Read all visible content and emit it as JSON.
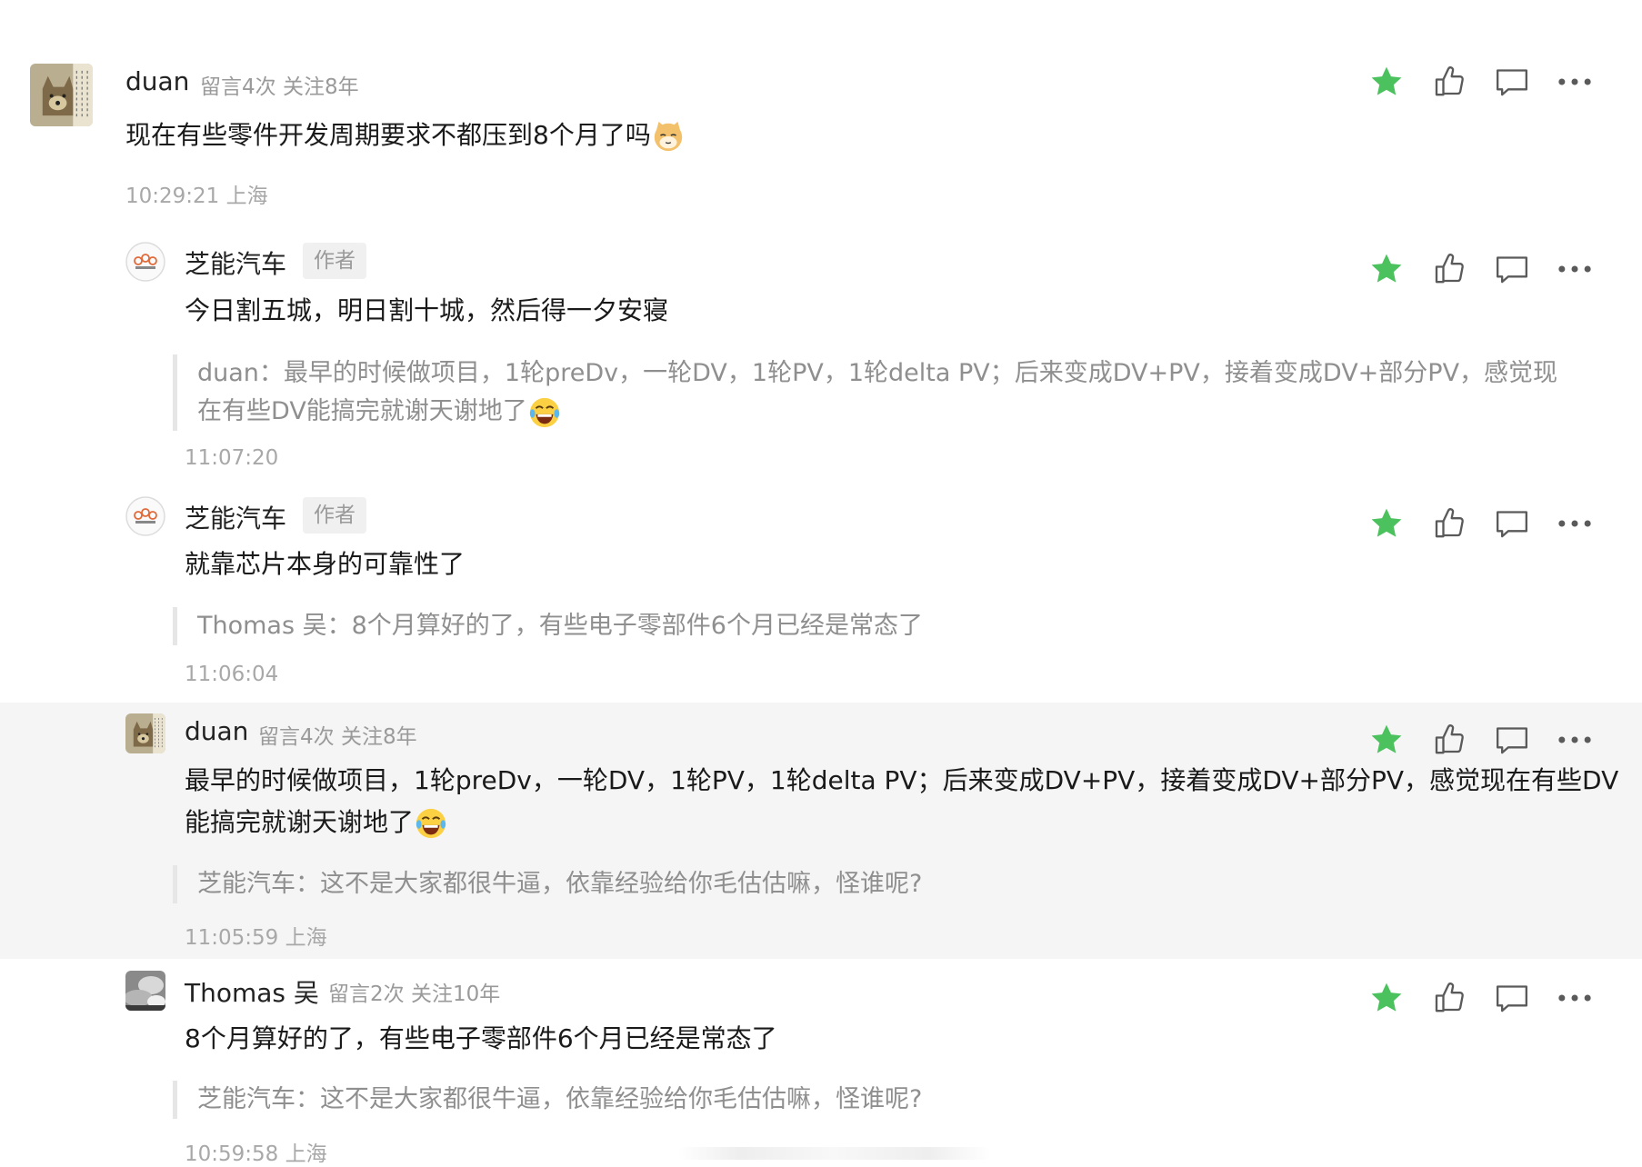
{
  "comments": [
    {
      "user": "duan",
      "meta": "留言4次 关注8年",
      "text": "现在有些零件开发周期要求不都压到8个月了吗",
      "time": "10:29:21 上海"
    },
    {
      "user": "芝能汽车",
      "badge": "作者",
      "text": "今日割五城，明日割十城，然后得一夕安寝",
      "quote_line1": "duan：最早的时候做项目，1轮preDv，一轮DV，1轮PV，1轮delta PV；后来变成DV+PV，接着变成DV+部分PV，感觉现",
      "quote_line2": "在有些DV能搞完就谢天谢地了",
      "time": "11:07:20"
    },
    {
      "user": "芝能汽车",
      "badge": "作者",
      "text": "就靠芯片本身的可靠性了",
      "quote": "Thomas 吴：8个月算好的了，有些电子零部件6个月已经是常态了",
      "time": "11:06:04"
    },
    {
      "user": "duan",
      "meta": "留言4次 关注8年",
      "text_line1": "最早的时候做项目，1轮preDv，一轮DV，1轮PV，1轮delta PV；后来变成DV+PV，接着变成DV+部分PV，感觉现在有些DV",
      "text_line2": "能搞完就谢天谢地了",
      "quote": "芝能汽车：这不是大家都很牛逼，依靠经验给你毛估估嘛，怪谁呢?",
      "time": "11:05:59 上海"
    },
    {
      "user": "Thomas 吴",
      "meta": "留言2次 关注10年",
      "text": "8个月算好的了，有些电子零部件6个月已经是常态了",
      "quote": "芝能汽车：这不是大家都很牛逼，依靠经验给你毛估估嘛，怪谁呢?",
      "time": "10:59:58 上海"
    }
  ],
  "colors": {
    "star": "#4cc25f",
    "icon": "#5a5a5a",
    "highlight_bg": "#f5f5f5"
  },
  "icons": [
    "star-icon",
    "thumbs-up-icon",
    "comment-icon",
    "more-icon"
  ]
}
